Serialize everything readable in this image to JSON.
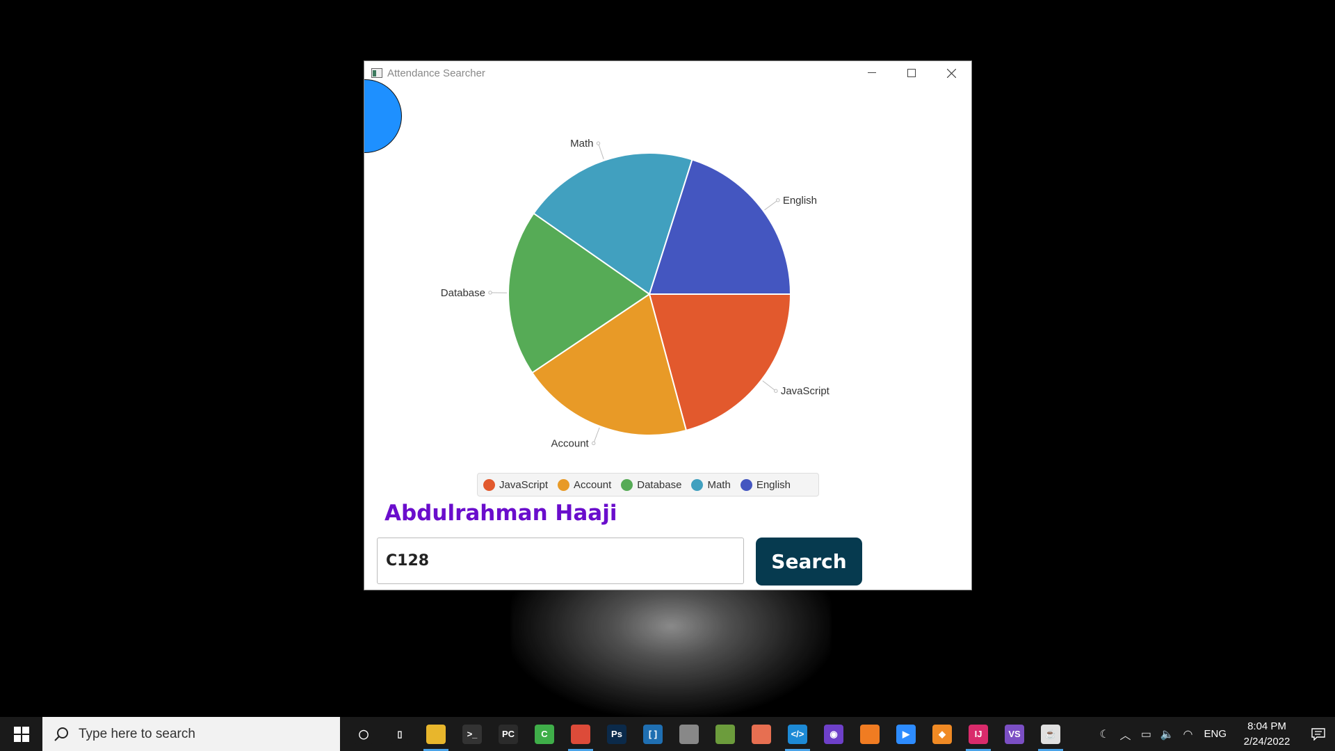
{
  "window": {
    "title": "Attendance Searcher"
  },
  "chart_data": {
    "type": "pie",
    "categories": [
      "JavaScript",
      "Account",
      "Database",
      "Math",
      "English"
    ],
    "values": [
      20.8,
      19.8,
      19.1,
      20.2,
      20.1
    ],
    "colors": [
      "#e2592d",
      "#e89a27",
      "#56ab56",
      "#41a0bf",
      "#4456c0"
    ],
    "start_angle_deg": 0,
    "direction": "clockwise",
    "legend_position": "bottom"
  },
  "student": {
    "name": "Abdulrahman Haaji"
  },
  "search": {
    "value": "C128",
    "button_label": "Search"
  },
  "taskbar": {
    "search_placeholder": "Type here to search",
    "language": "ENG",
    "time": "8:04 PM",
    "date": "2/24/2022",
    "apps": [
      {
        "name": "cortana-icon",
        "color": "#1a1a1a",
        "text": "◯"
      },
      {
        "name": "task-view-icon",
        "color": "#1a1a1a",
        "text": "▯"
      },
      {
        "name": "file-explorer-icon",
        "color": "#e8b62c",
        "text": ""
      },
      {
        "name": "terminal-icon",
        "color": "#333333",
        "text": ">_"
      },
      {
        "name": "pycharm-icon",
        "color": "#2b2b2b",
        "text": "PC"
      },
      {
        "name": "camtasia-icon",
        "color": "#3fae49",
        "text": "C"
      },
      {
        "name": "chrome-icon",
        "color": "#dd4b39",
        "text": ""
      },
      {
        "name": "photoshop-icon",
        "color": "#0b2a4a",
        "text": "Ps"
      },
      {
        "name": "brackets-icon",
        "color": "#1f6fb2",
        "text": "[ ]"
      },
      {
        "name": "database-icon",
        "color": "#888888",
        "text": ""
      },
      {
        "name": "dev-tool-icon",
        "color": "#6c9c3c",
        "text": ""
      },
      {
        "name": "git-icon",
        "color": "#e76f51",
        "text": ""
      },
      {
        "name": "vscode-icon",
        "color": "#1d8ad6",
        "text": "</>"
      },
      {
        "name": "github-icon",
        "color": "#6e40c9",
        "text": "◉"
      },
      {
        "name": "firefox-icon",
        "color": "#f07c22",
        "text": ""
      },
      {
        "name": "zoom-icon",
        "color": "#2d8cff",
        "text": "▶"
      },
      {
        "name": "app-icon-orange",
        "color": "#f08a24",
        "text": "◆"
      },
      {
        "name": "intellij-icon",
        "color": "#d92b6b",
        "text": "IJ"
      },
      {
        "name": "visual-studio-icon",
        "color": "#7b4fc4",
        "text": "VS"
      },
      {
        "name": "java-icon",
        "color": "#e0e0e0",
        "text": "☕"
      }
    ]
  }
}
